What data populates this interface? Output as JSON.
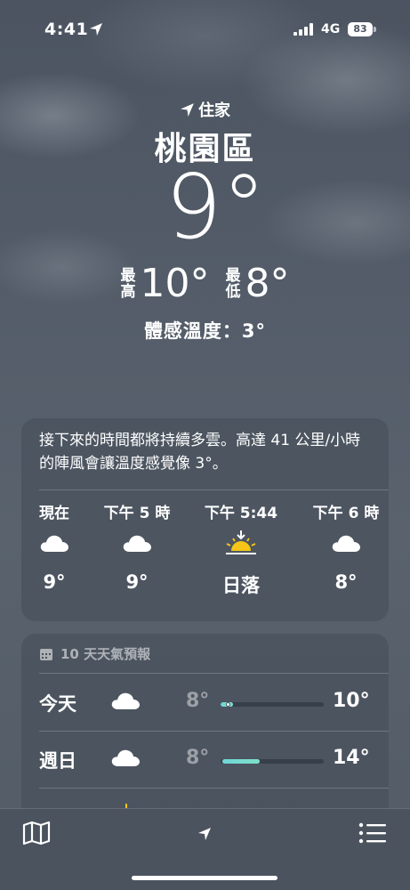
{
  "status_bar": {
    "time": "4:41",
    "network": "4G",
    "battery": "83"
  },
  "header": {
    "location_label": "住家",
    "city": "桃園區",
    "temperature": "9°",
    "high_label": "最高",
    "high": "10°",
    "low_label": "最低",
    "low": "8°",
    "feels_like": "體感溫度：3°"
  },
  "hourly": {
    "summary": "接下來的時間都將持續多雲。高達 41 公里/小時的陣風會讓溫度感覺像 3°。",
    "items": [
      {
        "time": "現在",
        "icon": "cloud-icon",
        "temp": "9°"
      },
      {
        "time": "下午 5 時",
        "icon": "cloud-icon",
        "temp": "9°"
      },
      {
        "time": "下午 5:44",
        "icon": "sunset-icon",
        "temp": "日落"
      },
      {
        "time": "下午 6 時",
        "icon": "cloud-icon",
        "temp": "8°"
      }
    ]
  },
  "forecast": {
    "title": "10 天天氣預報",
    "icon": "calendar-icon",
    "rows": [
      {
        "day": "今天",
        "icon": "cloud-icon",
        "low": "8°",
        "high": "10°"
      },
      {
        "day": "週日",
        "icon": "cloud-icon",
        "low": "8°",
        "high": "14°"
      }
    ]
  },
  "toolbar": {
    "left_icon": "map-icon",
    "center_icon": "location-arrow-icon",
    "right_icon": "list-icon"
  },
  "colors": {
    "background": "#545d69",
    "card": "#48505c",
    "temp_bar": "#6fd6d8",
    "sun": "#f5c518"
  }
}
